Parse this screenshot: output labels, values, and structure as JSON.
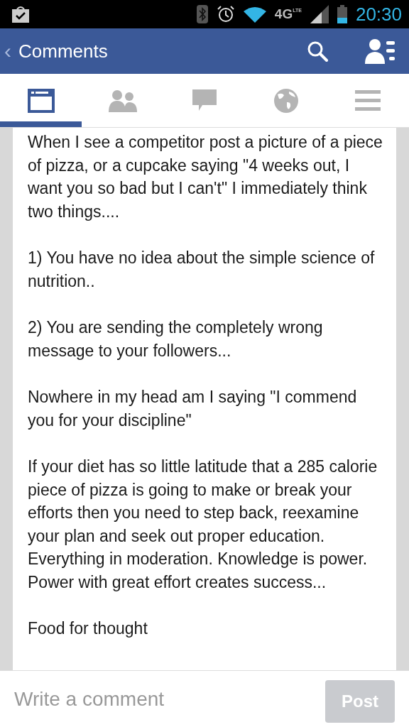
{
  "status_bar": {
    "network": "4G",
    "network_sub": "LTE",
    "time": "20:30"
  },
  "header": {
    "back": "‹",
    "title": "Comments"
  },
  "tabs": [
    {
      "kind": "feed",
      "selected": true
    },
    {
      "kind": "friends",
      "selected": false
    },
    {
      "kind": "messages",
      "selected": false
    },
    {
      "kind": "globe",
      "selected": false
    },
    {
      "kind": "menu",
      "selected": false
    }
  ],
  "comment": {
    "paragraphs": [
      "When I see a competitor post a picture of a piece of pizza, or a cupcake saying \"4 weeks out, I want you so bad but I can't\" I immediately think two things....",
      "1) You have no idea about the simple science of nutrition..",
      "2) You are sending the completely wrong message to your followers...",
      "Nowhere in my head am I saying \"I commend you for your discipline\"",
      "If your diet has so little latitude that a 285 calorie piece of pizza is going to make or break your efforts then you need to step back, reexamine your plan and seek out proper education. Everything in moderation. Knowledge is power. Power with great effort creates success...",
      "Food for thought"
    ]
  },
  "composer": {
    "placeholder": "Write a comment",
    "button": "Post",
    "disabled": true
  }
}
